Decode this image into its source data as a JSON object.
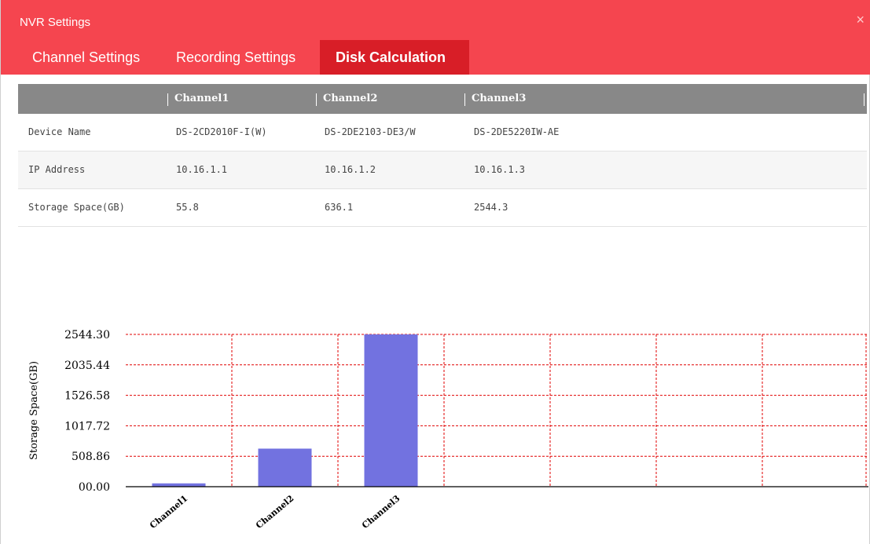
{
  "window": {
    "title": "NVR Settings",
    "close_icon": "×"
  },
  "tabs": [
    {
      "label": "Channel Settings",
      "active": false
    },
    {
      "label": "Recording Settings",
      "active": false
    },
    {
      "label": "Disk Calculation",
      "active": true
    }
  ],
  "table": {
    "columns": [
      "",
      "Channel1",
      "Channel2",
      "Channel3"
    ],
    "rows": [
      {
        "label": "Device Name",
        "values": [
          "DS-2CD2010F-I(W)",
          "DS-2DE2103-DE3/W",
          "DS-2DE5220IW-AE"
        ]
      },
      {
        "label": "IP Address",
        "values": [
          "10.16.1.1",
          "10.16.1.2",
          "10.16.1.3"
        ]
      },
      {
        "label": "Storage Space(GB)",
        "values": [
          "55.8",
          "636.1",
          "2544.3"
        ]
      }
    ]
  },
  "chart_data": {
    "type": "bar",
    "categories": [
      "Channel1",
      "Channel2",
      "Channel3"
    ],
    "values": [
      55.8,
      636.1,
      2544.3
    ],
    "ylabel": "Storage Space(GB)",
    "yticks": [
      "00.00",
      "508.86",
      "1017.72",
      "1526.58",
      "2035.44",
      "2544.30"
    ],
    "ylim": [
      0,
      2544.3
    ],
    "grid": true,
    "bar_color": "#7272e0",
    "grid_color": "#e00000",
    "vertical_grid_count": 7
  },
  "colors": {
    "titlebar": "#f5454f",
    "active_tab": "#d81e27",
    "table_header": "#888888"
  }
}
